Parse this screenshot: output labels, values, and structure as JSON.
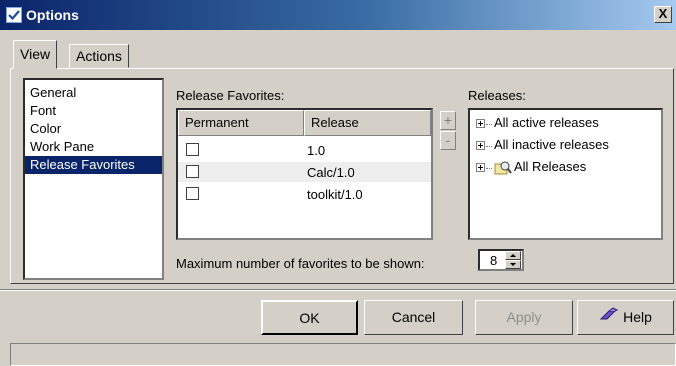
{
  "window": {
    "title": "Options",
    "close_label": "X"
  },
  "tabs": [
    {
      "label": "View",
      "active": true
    },
    {
      "label": "Actions",
      "active": false
    }
  ],
  "categories": [
    "General",
    "Font",
    "Color",
    "Work Pane",
    "Release Favorites"
  ],
  "selected_category": "Release Favorites",
  "release_favorites": {
    "label": "Release Favorites:",
    "columns": [
      "Permanent",
      "Release"
    ],
    "rows": [
      {
        "permanent": false,
        "release": "1.0"
      },
      {
        "permanent": false,
        "release": "Calc/1.0"
      },
      {
        "permanent": false,
        "release": "toolkit/1.0"
      }
    ],
    "add_label": "+",
    "remove_label": "-"
  },
  "releases": {
    "label": "Releases:",
    "nodes": [
      "All active releases",
      "All inactive releases",
      "All Releases"
    ]
  },
  "max_favorites": {
    "label": "Maximum number of favorites to be shown:",
    "value": "8"
  },
  "buttons": {
    "ok": "OK",
    "cancel": "Cancel",
    "apply": "Apply",
    "help": "Help"
  }
}
